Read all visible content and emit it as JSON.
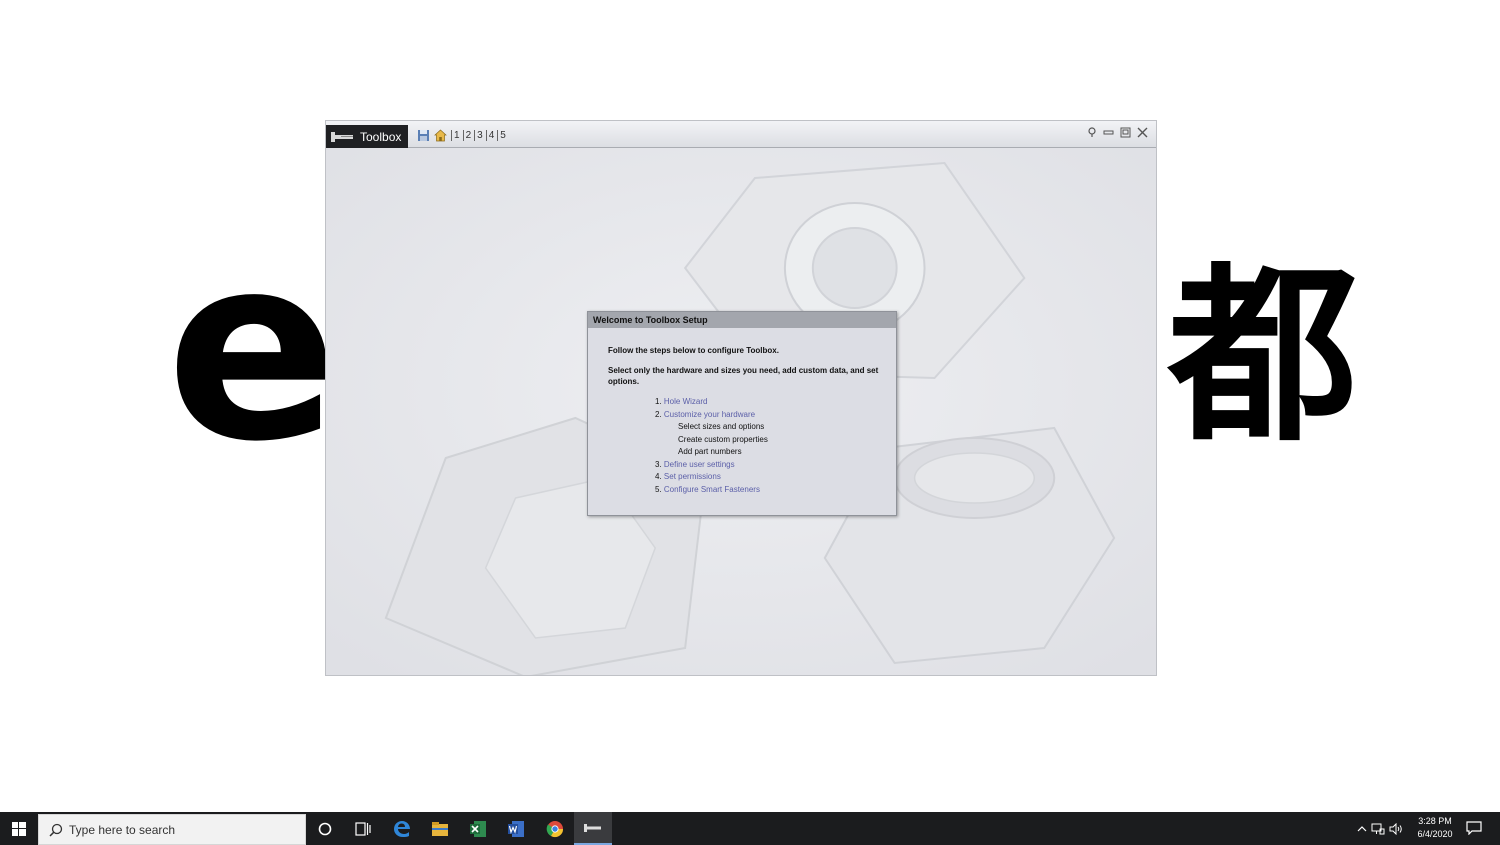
{
  "overlay": {
    "left_glyph": "e",
    "right_glyph": "都"
  },
  "window": {
    "tab_title": "Toolbox",
    "step_links": [
      "1",
      "2",
      "3",
      "4",
      "5"
    ],
    "icons": [
      "save-icon",
      "home-icon",
      "help-icon",
      "minimize-icon",
      "restore-icon",
      "close-icon"
    ]
  },
  "dialog": {
    "title": "Welcome to Toolbox Setup",
    "intro1": "Follow the steps below to configure Toolbox.",
    "intro2": "Select only the hardware and sizes you need, add custom data, and set options.",
    "steps": [
      {
        "num": "1.",
        "label": "Hole Wizard"
      },
      {
        "num": "2.",
        "label": "Customize your hardware"
      },
      {
        "num": "3.",
        "label": "Define user settings"
      },
      {
        "num": "4.",
        "label": "Set permissions"
      },
      {
        "num": "5.",
        "label": "Configure Smart Fasteners"
      }
    ],
    "substeps": [
      "Select sizes and options",
      "Create custom properties",
      "Add part numbers"
    ]
  },
  "taskbar": {
    "search_placeholder": "Type here to search",
    "time": "3:28 PM",
    "date": "6/4/2020",
    "pinned": [
      "edge-icon",
      "file-explorer-icon",
      "excel-icon",
      "word-icon",
      "chrome-icon",
      "toolbox-icon"
    ]
  }
}
